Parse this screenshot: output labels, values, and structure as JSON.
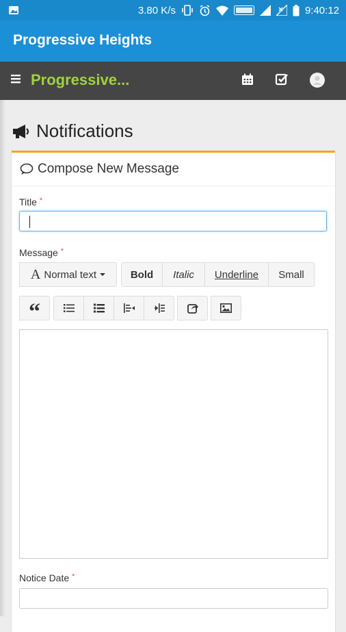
{
  "status_bar": {
    "speed": "3.80 K/s",
    "time": "9:40:12"
  },
  "app_bar": {
    "title": "Progressive Heights"
  },
  "nav_bar": {
    "brand": "Progressive..."
  },
  "page": {
    "title": "Notifications"
  },
  "panel": {
    "heading": "Compose New Message",
    "title_label": "Title",
    "message_label": "Message",
    "notice_date_label": "Notice Date",
    "required_mark": "*",
    "title_value": ""
  },
  "toolbar": {
    "font_style_glyph": "A",
    "font_style_label": "Normal text",
    "bold": "Bold",
    "italic": "Italic",
    "underline": "Underline",
    "small": "Small",
    "blockquote_glyph": "“"
  },
  "colors": {
    "status_bar": "#1989cc",
    "app_bar": "#1b90d6",
    "nav_bar": "#454545",
    "brand": "#9fd23e",
    "panel_accent": "#f4a51d"
  }
}
